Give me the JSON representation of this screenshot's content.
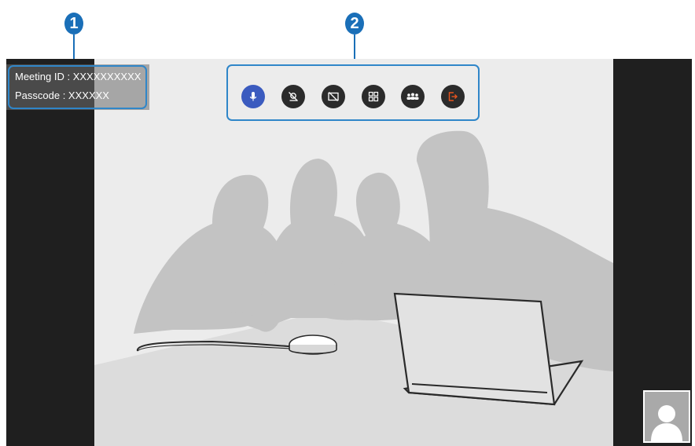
{
  "callouts": [
    {
      "label": "1"
    },
    {
      "label": "2"
    }
  ],
  "meeting_info": {
    "meeting_id": "Meeting ID : XXXXXXXXXX",
    "passcode": "Passcode : XXXXXX"
  },
  "toolbar": {
    "buttons": [
      {
        "name": "microphone",
        "icon": "microphone-icon",
        "active": true
      },
      {
        "name": "camera-off",
        "icon": "camera-off-icon",
        "active": false
      },
      {
        "name": "screen-share-off",
        "icon": "screen-share-off-icon",
        "active": false
      },
      {
        "name": "layout",
        "icon": "grid-layout-icon",
        "active": false
      },
      {
        "name": "participants",
        "icon": "participants-icon",
        "active": false
      },
      {
        "name": "leave",
        "icon": "leave-icon",
        "active": false
      }
    ]
  },
  "colors": {
    "callout": "#1a6fb8",
    "frame": "#2f86c9",
    "mic_active": "#3b5bbf",
    "leave": "#e8541e"
  }
}
